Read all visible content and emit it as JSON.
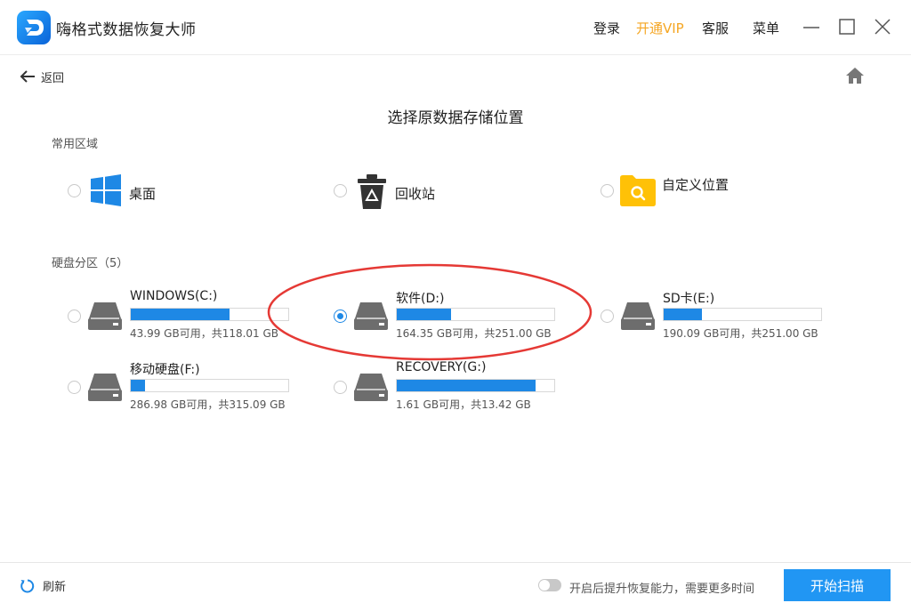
{
  "app": {
    "title": "嗨格式数据恢复大师"
  },
  "header": {
    "login": "登录",
    "vip": "开通VIP",
    "service": "客服",
    "menu": "菜单"
  },
  "nav": {
    "back_label": "返回"
  },
  "page": {
    "title": "选择原数据存储位置"
  },
  "common": {
    "label": "常用区域",
    "items": [
      {
        "label": "桌面",
        "icon": "windows-desktop-icon"
      },
      {
        "label": "回收站",
        "icon": "recycle-bin-icon"
      },
      {
        "label": "自定义位置",
        "icon": "folder-search-icon"
      }
    ]
  },
  "drives": {
    "label": "硬盘分区（5）",
    "items": [
      {
        "name": "WINDOWS(C:)",
        "info": "43.99 GB可用，共118.01 GB",
        "used_fraction": 0.627,
        "selected": false
      },
      {
        "name": "软件(D:)",
        "info": "164.35 GB可用，共251.00 GB",
        "used_fraction": 0.345,
        "selected": true
      },
      {
        "name": "SD卡(E:)",
        "info": "190.09 GB可用，共251.00 GB",
        "used_fraction": 0.243,
        "selected": false
      },
      {
        "name": "移动硬盘(F:)",
        "info": "286.98 GB可用，共315.09 GB",
        "used_fraction": 0.089,
        "selected": false
      },
      {
        "name": "RECOVERY(G:)",
        "info": "1.61 GB可用，共13.42 GB",
        "used_fraction": 0.88,
        "selected": false
      }
    ]
  },
  "footer": {
    "refresh_label": "刷新",
    "toggle_label": "开启后提升恢复能力，需要更多时间",
    "toggle_on": false,
    "start_label": "开始扫描"
  },
  "colors": {
    "accent": "#1e88e5",
    "vip": "#f5a623",
    "highlight": "#e53935"
  }
}
